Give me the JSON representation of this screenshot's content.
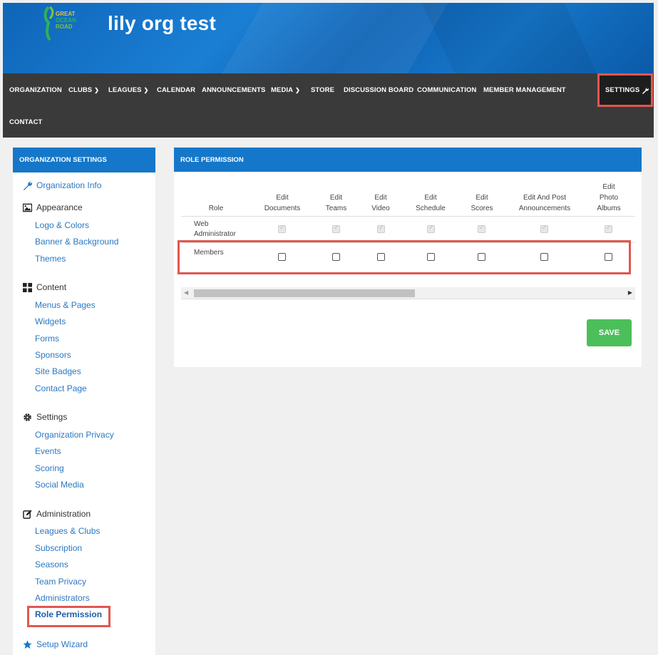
{
  "header": {
    "site_title": "lily org test",
    "logo_lines": [
      "GREAT",
      "OCEAN",
      "ROAD"
    ]
  },
  "nav": {
    "items": [
      {
        "label": "ORGANIZATION",
        "dropdown": false
      },
      {
        "label": "CLUBS",
        "dropdown": true
      },
      {
        "label": "LEAGUES",
        "dropdown": true
      },
      {
        "label": "CALENDAR",
        "dropdown": false
      },
      {
        "label": "ANNOUNCEMENTS",
        "dropdown": false
      },
      {
        "label": "MEDIA",
        "dropdown": true
      },
      {
        "label": "STORE",
        "dropdown": false
      },
      {
        "label": "DISCUSSION BOARD",
        "dropdown": false
      },
      {
        "label": "COMMUNICATION",
        "dropdown": false
      },
      {
        "label": "MEMBER MANAGEMENT",
        "dropdown": false
      },
      {
        "label": "SETTINGS",
        "icon": "wrench-icon"
      },
      {
        "label": "CONTACT",
        "dropdown": false
      }
    ]
  },
  "sidebar": {
    "title": "ORGANIZATION SETTINGS",
    "organization_info": "Organization Info",
    "appearance": {
      "label": "Appearance",
      "items": [
        "Logo & Colors",
        "Banner & Background",
        "Themes"
      ]
    },
    "content": {
      "label": "Content",
      "items": [
        "Menus & Pages",
        "Widgets",
        "Forms",
        "Sponsors",
        "Site Badges",
        "Contact Page"
      ]
    },
    "settings": {
      "label": "Settings",
      "items": [
        "Organization Privacy",
        "Events",
        "Scoring",
        "Social Media"
      ]
    },
    "administration": {
      "label": "Administration",
      "items": [
        "Leagues & Clubs",
        "Subscription",
        "Seasons",
        "Team Privacy",
        "Administrators",
        "Role Permission"
      ]
    },
    "setup_wizard": "Setup Wizard"
  },
  "main": {
    "title": "ROLE PERMISSION",
    "columns": [
      {
        "lines": [
          "Role"
        ]
      },
      {
        "lines": [
          "Edit",
          "Documents"
        ]
      },
      {
        "lines": [
          "Edit",
          "Teams"
        ]
      },
      {
        "lines": [
          "Edit",
          "Video"
        ]
      },
      {
        "lines": [
          "Edit",
          "Schedule"
        ]
      },
      {
        "lines": [
          "Edit",
          "Scores"
        ]
      },
      {
        "lines": [
          "Edit And Post",
          "Announcements"
        ]
      },
      {
        "lines": [
          "Edit",
          "Photo",
          "Albums"
        ]
      }
    ],
    "rows": [
      {
        "role_lines": [
          "Web",
          "Administrator"
        ],
        "checked": [
          true,
          true,
          true,
          true,
          true,
          true,
          true
        ],
        "disabled": true
      },
      {
        "role_lines": [
          "Members"
        ],
        "checked": [
          false,
          false,
          false,
          false,
          false,
          false,
          false
        ],
        "disabled": false
      }
    ],
    "save_label": "SAVE"
  },
  "colors": {
    "accent": "#1577c9",
    "nav_bg": "#3a3a3a",
    "highlight": "#e0574f",
    "save": "#4cbf5a",
    "link": "#2a78c2"
  }
}
